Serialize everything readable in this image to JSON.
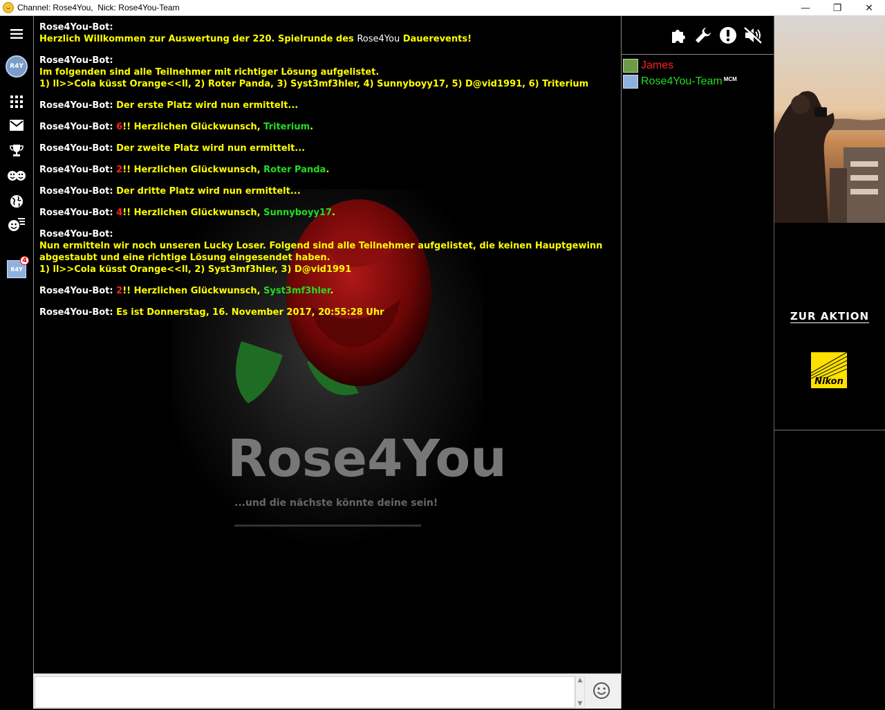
{
  "window": {
    "title": "Channel: Rose4You,  Nick: Rose4You-Team",
    "minimize": "—",
    "restore": "❐",
    "close": "✕"
  },
  "sidebar": {
    "avatar_label": "R4Y",
    "small_avatar_label": "R4Y",
    "badge_count": "4",
    "icons": [
      "menu-icon",
      "profile-avatar",
      "apps-grid-icon",
      "mail-icon",
      "trophy-icon",
      "smiley-faces-icon",
      "globe-icon",
      "smiley-list-icon",
      "notifications-avatar"
    ]
  },
  "chat": {
    "background_slogan": "...und die nächste könnte deine sein!",
    "background_logo": "Rose4You",
    "messages": [
      {
        "who": "Rose4You-Bot:",
        "lines": [
          [
            "txt",
            "Herzlich Willkommen zur Auswertung der  220. Spielrunde des "
          ],
          [
            "plain",
            "Rose4You"
          ],
          [
            "txt",
            " Dauerevents!"
          ]
        ],
        "break_after_who": true
      },
      {
        "who": "Rose4You-Bot:",
        "break_after_who": true,
        "l1": "Im folgenden sind alle Teilnehmer mit richtiger Lösung aufgelistet.",
        "l2": "1) ll>>Cola küsst Orange<<ll, 2) Roter Panda, 3) Syst3mf3hler, 4) Sunnyboyy17, 5) D@vid1991, 6) Triterium"
      },
      {
        "who": "Rose4You-Bot:",
        "text": "Der erste Platz wird nun ermittelt..."
      },
      {
        "who": "Rose4You-Bot:",
        "num": "6",
        "text": "!! Herzlichen Glückwunsch, ",
        "winner": "Triterium",
        "end": "."
      },
      {
        "who": "Rose4You-Bot:",
        "text": "Der zweite Platz wird nun ermittelt..."
      },
      {
        "who": "Rose4You-Bot:",
        "num": "2",
        "text": "!! Herzlichen Glückwunsch, ",
        "winner": "Roter Panda",
        "end": "."
      },
      {
        "who": "Rose4You-Bot:",
        "text": "Der dritte Platz wird nun ermittelt..."
      },
      {
        "who": "Rose4You-Bot:",
        "num": "4",
        "text": "!! Herzlichen Glückwunsch, ",
        "winner": "Sunnyboyy17",
        "end": "."
      },
      {
        "who": "Rose4You-Bot:",
        "break_after_who": true,
        "l1": "Nun ermitteln wir noch unseren Lucky Loser. Folgend sind alle Teilnehmer aufgelistet, die keinen Hauptgewinn abgestaubt und eine richtige Lösung eingesendet haben.",
        "l2": "1) ll>>Cola küsst Orange<<ll, 2) Syst3mf3hler, 3) D@vid1991"
      },
      {
        "who": "Rose4You-Bot:",
        "num": "2",
        "text": "!! Herzlichen Glückwunsch, ",
        "winner": "Syst3mf3hler",
        "end": "."
      },
      {
        "who": "Rose4You-Bot:",
        "text": "Es ist Donnerstag, 16. November 2017, 20:55:28 Uhr"
      }
    ]
  },
  "input": {
    "value": "",
    "placeholder": ""
  },
  "toolbar": {
    "icons": [
      "puzzle-icon",
      "wrench-icon",
      "alert-icon",
      "mute-icon"
    ]
  },
  "users": [
    {
      "name": "James",
      "color": "#ff2020",
      "avatar": "green"
    },
    {
      "name": "Rose4You-Team",
      "color": "#22dd22",
      "avatar": "blue",
      "tag": "MCM"
    }
  ],
  "ad": {
    "cta": "ZUR AKTION",
    "brand": "Nikon"
  },
  "colors": {
    "bot_name": "#ffffff",
    "bot_text": "#ffff00",
    "winner": "#22dd22",
    "number": "#ff2020",
    "background": "#000000"
  }
}
